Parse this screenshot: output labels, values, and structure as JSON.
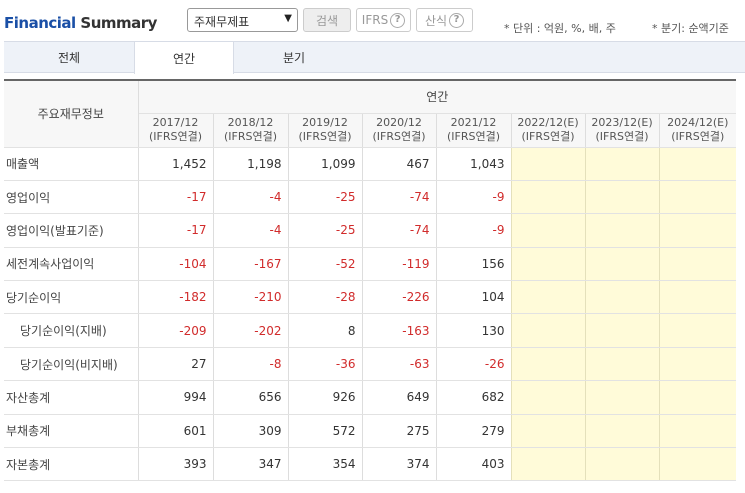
{
  "header": {
    "title_part1": "Financial",
    "title_part2": "Summary",
    "statement_select": "주재무제표",
    "search_button": "검색",
    "ifrs_button": "IFRS",
    "formula_button": "산식",
    "unit_note": "* 단위 : 억원, %, 배, 주",
    "quarter_note": "* 분기: 순액기준"
  },
  "tabs": [
    "전체",
    "연간",
    "분기"
  ],
  "selected_tab": "연간",
  "table": {
    "row_header": "주요재무정보",
    "group_header": "연간",
    "columns": [
      {
        "period": "2017/12",
        "basis": "(IFRS연결)"
      },
      {
        "period": "2018/12",
        "basis": "(IFRS연결)"
      },
      {
        "period": "2019/12",
        "basis": "(IFRS연결)"
      },
      {
        "period": "2020/12",
        "basis": "(IFRS연결)"
      },
      {
        "period": "2021/12",
        "basis": "(IFRS연결)"
      },
      {
        "period": "2022/12(E)",
        "basis": "(IFRS연결)"
      },
      {
        "period": "2023/12(E)",
        "basis": "(IFRS연결)"
      },
      {
        "period": "2024/12(E)",
        "basis": "(IFRS연결)"
      }
    ],
    "rows": [
      {
        "label": "매출액",
        "values": [
          "1,452",
          "1,198",
          "1,099",
          "467",
          "1,043",
          "",
          "",
          ""
        ]
      },
      {
        "label": "영업이익",
        "values": [
          "-17",
          "-4",
          "-25",
          "-74",
          "-9",
          "",
          "",
          ""
        ]
      },
      {
        "label": "영업이익(발표기준)",
        "values": [
          "-17",
          "-4",
          "-25",
          "-74",
          "-9",
          "",
          "",
          ""
        ]
      },
      {
        "label": "세전계속사업이익",
        "values": [
          "-104",
          "-167",
          "-52",
          "-119",
          "156",
          "",
          "",
          ""
        ]
      },
      {
        "label": "당기순이익",
        "values": [
          "-182",
          "-210",
          "-28",
          "-226",
          "104",
          "",
          "",
          ""
        ]
      },
      {
        "label": "당기순이익(지배)",
        "values": [
          "-209",
          "-202",
          "8",
          "-163",
          "130",
          "",
          "",
          ""
        ]
      },
      {
        "label": "당기순이익(비지배)",
        "values": [
          "27",
          "-8",
          "-36",
          "-63",
          "-26",
          "",
          "",
          ""
        ]
      },
      {
        "label": "자산총계",
        "values": [
          "994",
          "656",
          "926",
          "649",
          "682",
          "",
          "",
          ""
        ]
      },
      {
        "label": "부채총계",
        "values": [
          "601",
          "309",
          "572",
          "275",
          "279",
          "",
          "",
          ""
        ]
      },
      {
        "label": "자본총계",
        "values": [
          "393",
          "347",
          "354",
          "374",
          "403",
          "",
          "",
          ""
        ]
      }
    ]
  }
}
